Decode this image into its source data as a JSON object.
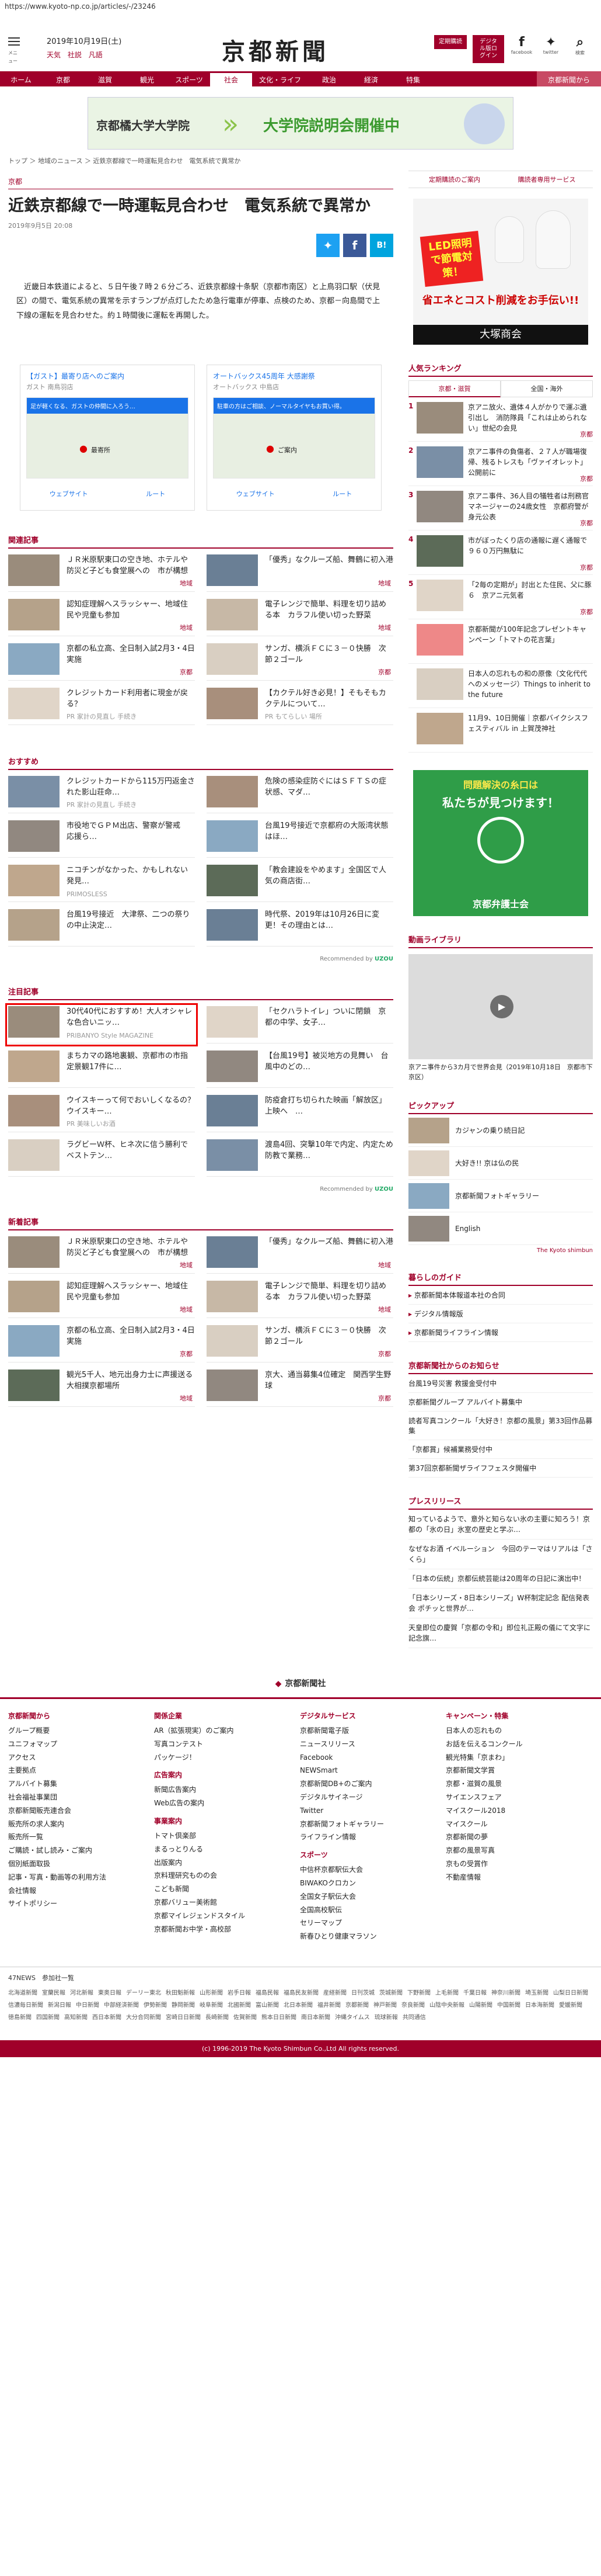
{
  "url": "https://www.kyoto-np.co.jp/articles/-/23246",
  "header": {
    "menu_label": "メニュー",
    "date": "2019年10月19日(土)",
    "links": [
      "天気",
      "社説",
      "凡語"
    ],
    "logo": "京都新聞",
    "btn_edition": "定期購読",
    "btn_digital": "デジタル版ログイン",
    "facebook_label": "facebook",
    "twitter_label": "twitter",
    "search_label": "検索"
  },
  "nav": {
    "items": [
      "ホーム",
      "京都",
      "滋賀",
      "観光",
      "スポーツ",
      "社会",
      "文化・ライフ",
      "政治",
      "経済",
      "特集"
    ],
    "active_index": 5,
    "extra": "京都新聞から"
  },
  "banner": {
    "left": "京都橘大学大学院",
    "right": "大学院説明会開催中"
  },
  "breadcrumb": "トップ ＞ 地域のニュース ＞ 近鉄京都線で一時運転見合わせ　電気系統で異常か",
  "article": {
    "area": "京都",
    "title": "近鉄京都線で一時運転見合わせ　電気系統で異常か",
    "date": "2019年9月5日 20:08",
    "body": "近畿日本鉄道によると、５日午後７時２６分ごろ、近鉄京都線十条駅（京都市南区）と上鳥羽口駅（伏見区）の間で、電気系統の異常を示すランプが点灯したため急行電車が停車、点検のため、京都－向島間で上下線の運転を見合わせた。約１時間後に運転を再開した。"
  },
  "ads": [
    {
      "name": "【ガスト】最寄り店へのご案内",
      "sub": "ガスト 南鳥羽店",
      "inner": "足が軽くなる、ガストの仲間に入ろう…",
      "place": "最寄所",
      "b1": "ウェブサイト",
      "b2": "ルート"
    },
    {
      "name": "オートバックス45周年 大感謝祭",
      "sub": "オートバックス 中島店",
      "inner": "駐車の方はご相談、ノーマルタイヤもお買い得。",
      "place": "ご案内",
      "b1": "ウェブサイト",
      "b2": "ルート"
    }
  ],
  "related": {
    "title": "関連記事",
    "items": [
      {
        "text": "ＪＲ米原駅東口の空き地、ホテルや防災ど子ども食堂展への　市が構想",
        "src": "地域"
      },
      {
        "text": "「優秀」なクルーズ船、舞鶴に初入港",
        "src": "地域"
      },
      {
        "text": "認知症理解へスラッシャー、地域住民や児童も参加",
        "src": "地域"
      },
      {
        "text": "電子レンジで簡単、料理を切り詰める本　カラフル使い切った野菜",
        "src": "地域"
      },
      {
        "text": "京都の私立高、全日制入試2月3・4日実施",
        "src": "京都"
      },
      {
        "text": "サンガ、横浜ＦＣに３－０快勝　次節２ゴール",
        "src": "京都"
      },
      {
        "text": "クレジットカード利用者に現金が戻る？",
        "src": "PR 家計の見直し 手続き"
      },
      {
        "text": "【カクテル好き必見！】そもそもカクテルについて…",
        "src": "PR もてらしい 場所"
      }
    ]
  },
  "osusume": {
    "title": "おすすめ",
    "items": [
      {
        "text": "クレジットカードから115万円返金された影山荘命…",
        "src": "PR 家計の見直し 手続き"
      },
      {
        "text": "危険の感染症防ぐにはＳＦＴＳの症状感、マダ…",
        "src": ""
      },
      {
        "text": "市役地でＧＰＭ出店、警察が警戒　応援ら…",
        "src": ""
      },
      {
        "text": "台風19号接近で京都府の大阪湾状態はほ…",
        "src": ""
      },
      {
        "text": "ニコチンがなかった、かもしれない発見…",
        "src": "PRIMOSLESS"
      },
      {
        "text": "「教会建設をやめます」全国区で人気の商店街…",
        "src": ""
      },
      {
        "text": "台風19号接近　大津祭、二つの祭りの中止決定…",
        "src": ""
      },
      {
        "text": "時代祭、2019年は10月26日に変更！その理由とは…",
        "src": ""
      }
    ],
    "recommended": "Recommended by"
  },
  "chuumoku": {
    "title": "注目記事",
    "items": [
      {
        "text": "30代40代におすすめ！大人オシャレな色合いニッ…",
        "src": "PRIBANYO Style MAGAZINE"
      },
      {
        "text": "「セクハラトイレ」ついに閉鎖　京都の中学、女子…",
        "src": ""
      },
      {
        "text": "まちカマの路地裏観、京都市の市指定景観17件に…",
        "src": ""
      },
      {
        "text": "【台風19号】被災地方の見舞い　台風中のどの…",
        "src": ""
      },
      {
        "text": "ウイスキーって何でおいしくなるの？ウイスキー…",
        "src": "PR 美味しいお酒"
      },
      {
        "text": "防疫倉打ち切られた映画「解放区」上映へ　…",
        "src": ""
      },
      {
        "text": "ラグビーＷ杯、ヒネ次に信う勝利でベストテン…",
        "src": ""
      },
      {
        "text": "渡島4回、突撃10年で内定、内定ため　防教で業務…",
        "src": ""
      }
    ]
  },
  "latest": {
    "title": "新着記事",
    "items": [
      {
        "text": "ＪＲ米原駅東口の空き地、ホテルや防災ど子ども食堂展への　市が構想",
        "src": "地域"
      },
      {
        "text": "「優秀」なクルーズ船、舞鶴に初入港",
        "src": "地域"
      },
      {
        "text": "認知症理解へスラッシャー、地域住民や児童も参加",
        "src": "地域"
      },
      {
        "text": "電子レンジで簡単、料理を切り詰める本　カラフル使い切った野菜",
        "src": "地域"
      },
      {
        "text": "京都の私立高、全日制入試2月3・4日実施",
        "src": "京都"
      },
      {
        "text": "サンガ、横浜ＦＣに３－０快勝　次節２ゴール",
        "src": "京都"
      },
      {
        "text": "観光5千人、地元出身力士に声援送る　大相撲京都場所",
        "src": "地域"
      },
      {
        "text": "京大、通当募集4位確定　関西学生野球",
        "src": "京都"
      }
    ]
  },
  "side": {
    "links": [
      "定期購読のご案内",
      "購読者専用サービス"
    ],
    "ad": {
      "tag": "LED照明で節電対策！",
      "txt1": "省エネとコスト削減をお手伝い!!",
      "txt2": "大塚商会"
    },
    "ranking": {
      "title": "人気ランキング",
      "tabs": [
        "京都・滋賀",
        "全国・海外"
      ],
      "items": [
        {
          "text": "京アニ放火、遺体４人がかりで運ぶ遺引出し　消防隊員「これは止められない」世紀の会見",
          "area": "京都"
        },
        {
          "text": "京アニ事件の負傷者、２７人が職場復帰、残るトレスも「ヴァイオレット」公開前に",
          "area": "京都"
        },
        {
          "text": "京アニ事件、36人目の犠牲者は刑務官マネージャーの24歳女性　京都府警が身元公表",
          "area": "京都"
        },
        {
          "text": "市がぼったくり店の通報に遅く通報で　９６０万円無駄に",
          "area": "京都"
        },
        {
          "text": "「2毎の定期が」討出とた住民、父に豚６　京アニ元気者　",
          "area": "京都"
        },
        {
          "text": "京都新聞が100年記念プレゼントキャンペーン「トマトの花言葉」",
          "area": ""
        },
        {
          "text": "日本人の忘れもの和の原像（文化代代へのメッセージ）Things to inherit to the future",
          "area": ""
        },
        {
          "text": "11月9、10日開催｜京都バイクシスフェスティバル in 上賀茂神社",
          "area": ""
        }
      ]
    },
    "bengoshi": {
      "t1": "問題解決の糸口は",
      "t2": "私たちが見つけます！",
      "t3": "京都弁護士会"
    },
    "video": {
      "title": "動画ライブラリ",
      "caption": "京アニ事件から3カ月で世界会見（2019年10月18日　京都市下京区）"
    },
    "pickup": {
      "title": "ピックアップ",
      "items": [
        "カジャンの乗り続日記",
        "大好き!! 京は仏の民",
        "京都新聞フォトギャラリー",
        "English"
      ],
      "foot": "The Kyoto shimbun"
    },
    "life": {
      "title": "暮らしのガイド",
      "items": [
        "京都新聞本体報道本社の合同",
        "デジタル情報版",
        "京都新聞ライフライン情報"
      ]
    },
    "info": {
      "title": "京都新聞社からのお知らせ",
      "items": [
        "台風19号災害 救援金受付中",
        "京都新聞グループ アルバイト募集中",
        "読者写真コンクール「大好き！京都の風景」第33回作品募集",
        "「京都賞」候補業務受付中",
        "第37回京都新聞ザライフフェスタ開催中"
      ]
    },
    "press": {
      "title": "プレスリリース",
      "items": [
        "知っているようで、意外と知らない氷の主要に知ろう！京都の「氷の日」氷室の歴史と学ぶ…",
        "なぜなお酒 イベルーション　今回のテーマはリアルは「さくら」",
        "「日本の伝統」京都伝統芸能は20周年の日記に演出中！",
        "「日本シリーズ・8日本シリーズ」W杯制定記念 配信発表会 ポチッと世界が…",
        "天皇即位の慶賀「京都の令和」即位礼正殿の儀にて文字に記念旗…"
      ]
    }
  },
  "footer": {
    "brand": "京都新聞社",
    "cols": [
      {
        "h": "京都新聞から",
        "items": [
          "グループ概要",
          "ユニフォマップ",
          "アクセス",
          "主要拠点",
          "アルバイト募集",
          "社会福祉事業団",
          "京都新聞販売連合会",
          "販売所の求人案内",
          "販売所一覧",
          "ご購読・試し読み・ご案内",
          "個別紙面取扱",
          "記事・写真・動画等の利用方法",
          "会社情報",
          "サイトポリシー"
        ]
      },
      {
        "h": "関係企業",
        "items": [
          "AR（拡張現実）のご案内",
          "写真コンテスト",
          "パッケージ！"
        ]
      },
      {
        "h": "広告案内",
        "items": [
          "新聞広告案内",
          "Web広告の案内"
        ]
      },
      {
        "h": "事業案内",
        "items": [
          "トマト倶楽部",
          "まるっとりんる",
          "出版案内",
          "京料理研究ものの会",
          "こども新聞",
          "京都バリュー美術館",
          "京都マイレジェンドスタイル",
          "京都新聞お中学・高校部"
        ]
      },
      {
        "h": "デジタルサービス",
        "items": [
          "京都新聞電子版",
          "ニュースリリース",
          "Facebook",
          "NEWSmart",
          "京都新聞DB+のご案内",
          "デジタルサイネージ",
          "Twitter",
          "京都新聞フォトギャラリー",
          "ライフライン情報"
        ]
      },
      {
        "h": "スポーツ",
        "items": [
          "中信杯京都駅伝大会",
          "BIWAKOクロカン",
          "全国女子駅伝大会",
          "全国高校駅伝",
          "セリーマップ",
          "新春ひとり健康マラソン"
        ]
      },
      {
        "h": "キャンペーン・特集",
        "items": [
          "日本人の忘れもの",
          "お話を伝えるコンクール",
          "観光特集「京まわ」",
          "京都新聞文学賞",
          "京都・滋賀の風景",
          "サイエンスフェア",
          "マイスクール2018",
          "マイスクール",
          "京都新聞の夢",
          "京都の風景写真",
          "京もの受賞作",
          "不動産情報"
        ]
      }
    ],
    "ext_title": "47NEWS　参加社一覧",
    "ext_links": [
      "北海道新聞",
      "室蘭民報",
      "河北新報",
      "東奥日報",
      "デーリー東北",
      "秋田魁新報",
      "山形新聞",
      "岩手日報",
      "福島民報",
      "福島民友新聞",
      "産経新聞",
      "日刊茨城",
      "茨城新聞",
      "下野新聞",
      "上毛新聞",
      "千葉日報",
      "神奈川新聞",
      "埼玉新聞",
      "山梨日日新聞",
      "信濃毎日新聞",
      "新潟日報",
      "中日新聞",
      "中部経済新聞",
      "伊勢新聞",
      "静岡新聞",
      "岐阜新聞",
      "北國新聞",
      "富山新聞",
      "北日本新聞",
      "福井新聞",
      "京都新聞",
      "神戸新聞",
      "奈良新聞",
      "山陰中央新報",
      "山陽新聞",
      "中国新聞",
      "日本海新聞",
      "愛媛新聞",
      "徳島新聞",
      "四国新聞",
      "高知新聞",
      "西日本新聞",
      "大分合同新聞",
      "宮崎日日新聞",
      "長崎新聞",
      "佐賀新聞",
      "熊本日日新聞",
      "南日本新聞",
      "沖縄タイムス",
      "琉球新報",
      "共同通信"
    ],
    "copyright": "(c) 1996-2019 The Kyoto Shimbun Co.,Ltd All rights reserved."
  },
  "colors": {
    "brand": "#a0002a"
  }
}
